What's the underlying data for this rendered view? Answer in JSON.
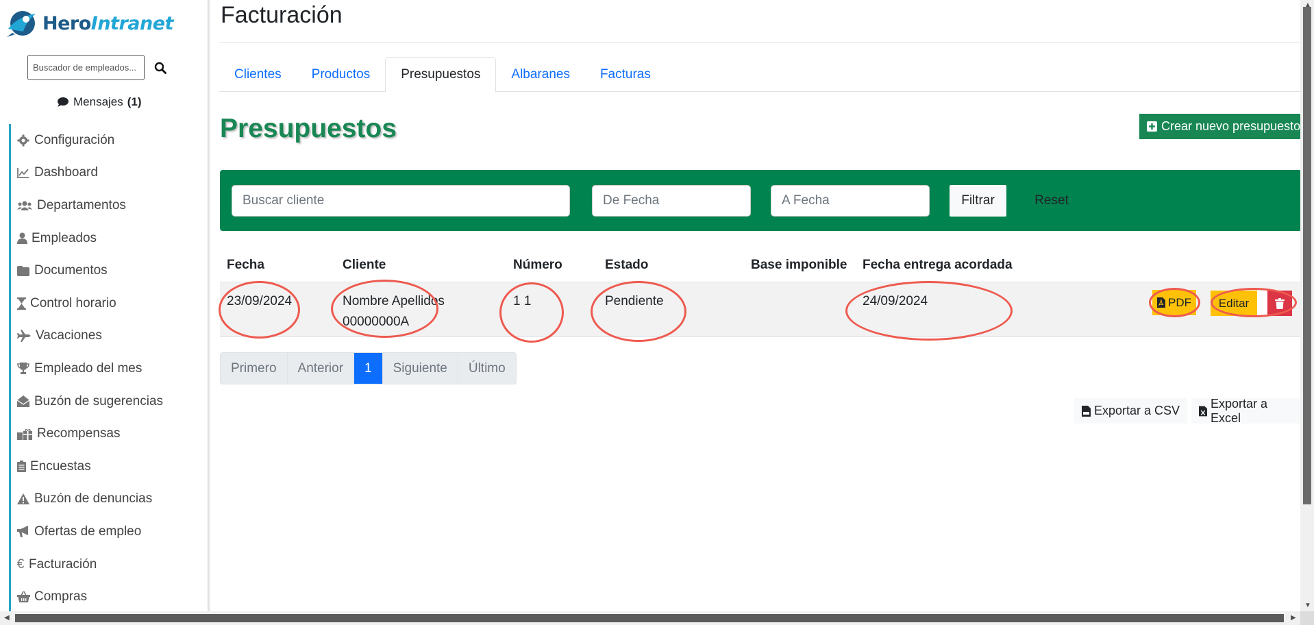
{
  "brand": {
    "name_a": "Hero",
    "name_b": "Intranet"
  },
  "sidebar": {
    "search_placeholder": "Buscador de empleados...",
    "messages_label": "Mensajes",
    "messages_count": "(1)",
    "items": [
      {
        "label": "Configuración",
        "icon": "gear-icon"
      },
      {
        "label": "Dashboard",
        "icon": "chart-line-icon"
      },
      {
        "label": "Departamentos",
        "icon": "users-icon"
      },
      {
        "label": "Empleados",
        "icon": "user-icon"
      },
      {
        "label": "Documentos",
        "icon": "folder-icon"
      },
      {
        "label": "Control horario",
        "icon": "hourglass-icon"
      },
      {
        "label": "Vacaciones",
        "icon": "plane-icon"
      },
      {
        "label": "Empleado del mes",
        "icon": "trophy-icon"
      },
      {
        "label": "Buzón de sugerencias",
        "icon": "envelope-open-icon"
      },
      {
        "label": "Recompensas",
        "icon": "gifts-icon"
      },
      {
        "label": "Encuestas",
        "icon": "clipboard-icon"
      },
      {
        "label": "Buzón de denuncias",
        "icon": "warning-icon"
      },
      {
        "label": "Ofertas de empleo",
        "icon": "megaphone-icon"
      },
      {
        "label": "Facturación",
        "icon": "euro-icon"
      },
      {
        "label": "Compras",
        "icon": "basket-icon"
      }
    ]
  },
  "header": {
    "title": "Facturación"
  },
  "tabs": [
    {
      "label": "Clientes"
    },
    {
      "label": "Productos"
    },
    {
      "label": "Presupuestos"
    },
    {
      "label": "Albaranes"
    },
    {
      "label": "Facturas"
    }
  ],
  "section": {
    "title": "Presupuestos",
    "create_label": "Crear nuevo presupuesto"
  },
  "filters": {
    "client_placeholder": "Buscar cliente",
    "from_placeholder": "De Fecha",
    "to_placeholder": "A Fecha",
    "filter_label": "Filtrar",
    "reset_label": "Reset"
  },
  "table": {
    "headers": [
      "Fecha",
      "Cliente",
      "Número",
      "Estado",
      "Base imponible",
      "Fecha entrega acordada"
    ],
    "rows": [
      {
        "fecha": "23/09/2024",
        "cliente_nombre": "Nombre Apellidos",
        "cliente_id": "00000000A",
        "numero": "1 1",
        "estado": "Pendiente",
        "base": "",
        "entrega": "24/09/2024",
        "pdf_label": "PDF",
        "edit_label": "Editar"
      }
    ]
  },
  "pagination": [
    "Primero",
    "Anterior",
    "1",
    "Siguiente",
    "Último"
  ],
  "export": {
    "csv_label": "Exportar a CSV",
    "excel_label": "Exportar a Excel"
  },
  "colors": {
    "primary_green": "#198754",
    "filter_green": "#00834f",
    "annotation_red": "#ee5a4f",
    "link_blue": "#0d6efd",
    "warning": "#ffc107",
    "danger": "#dc3545"
  }
}
